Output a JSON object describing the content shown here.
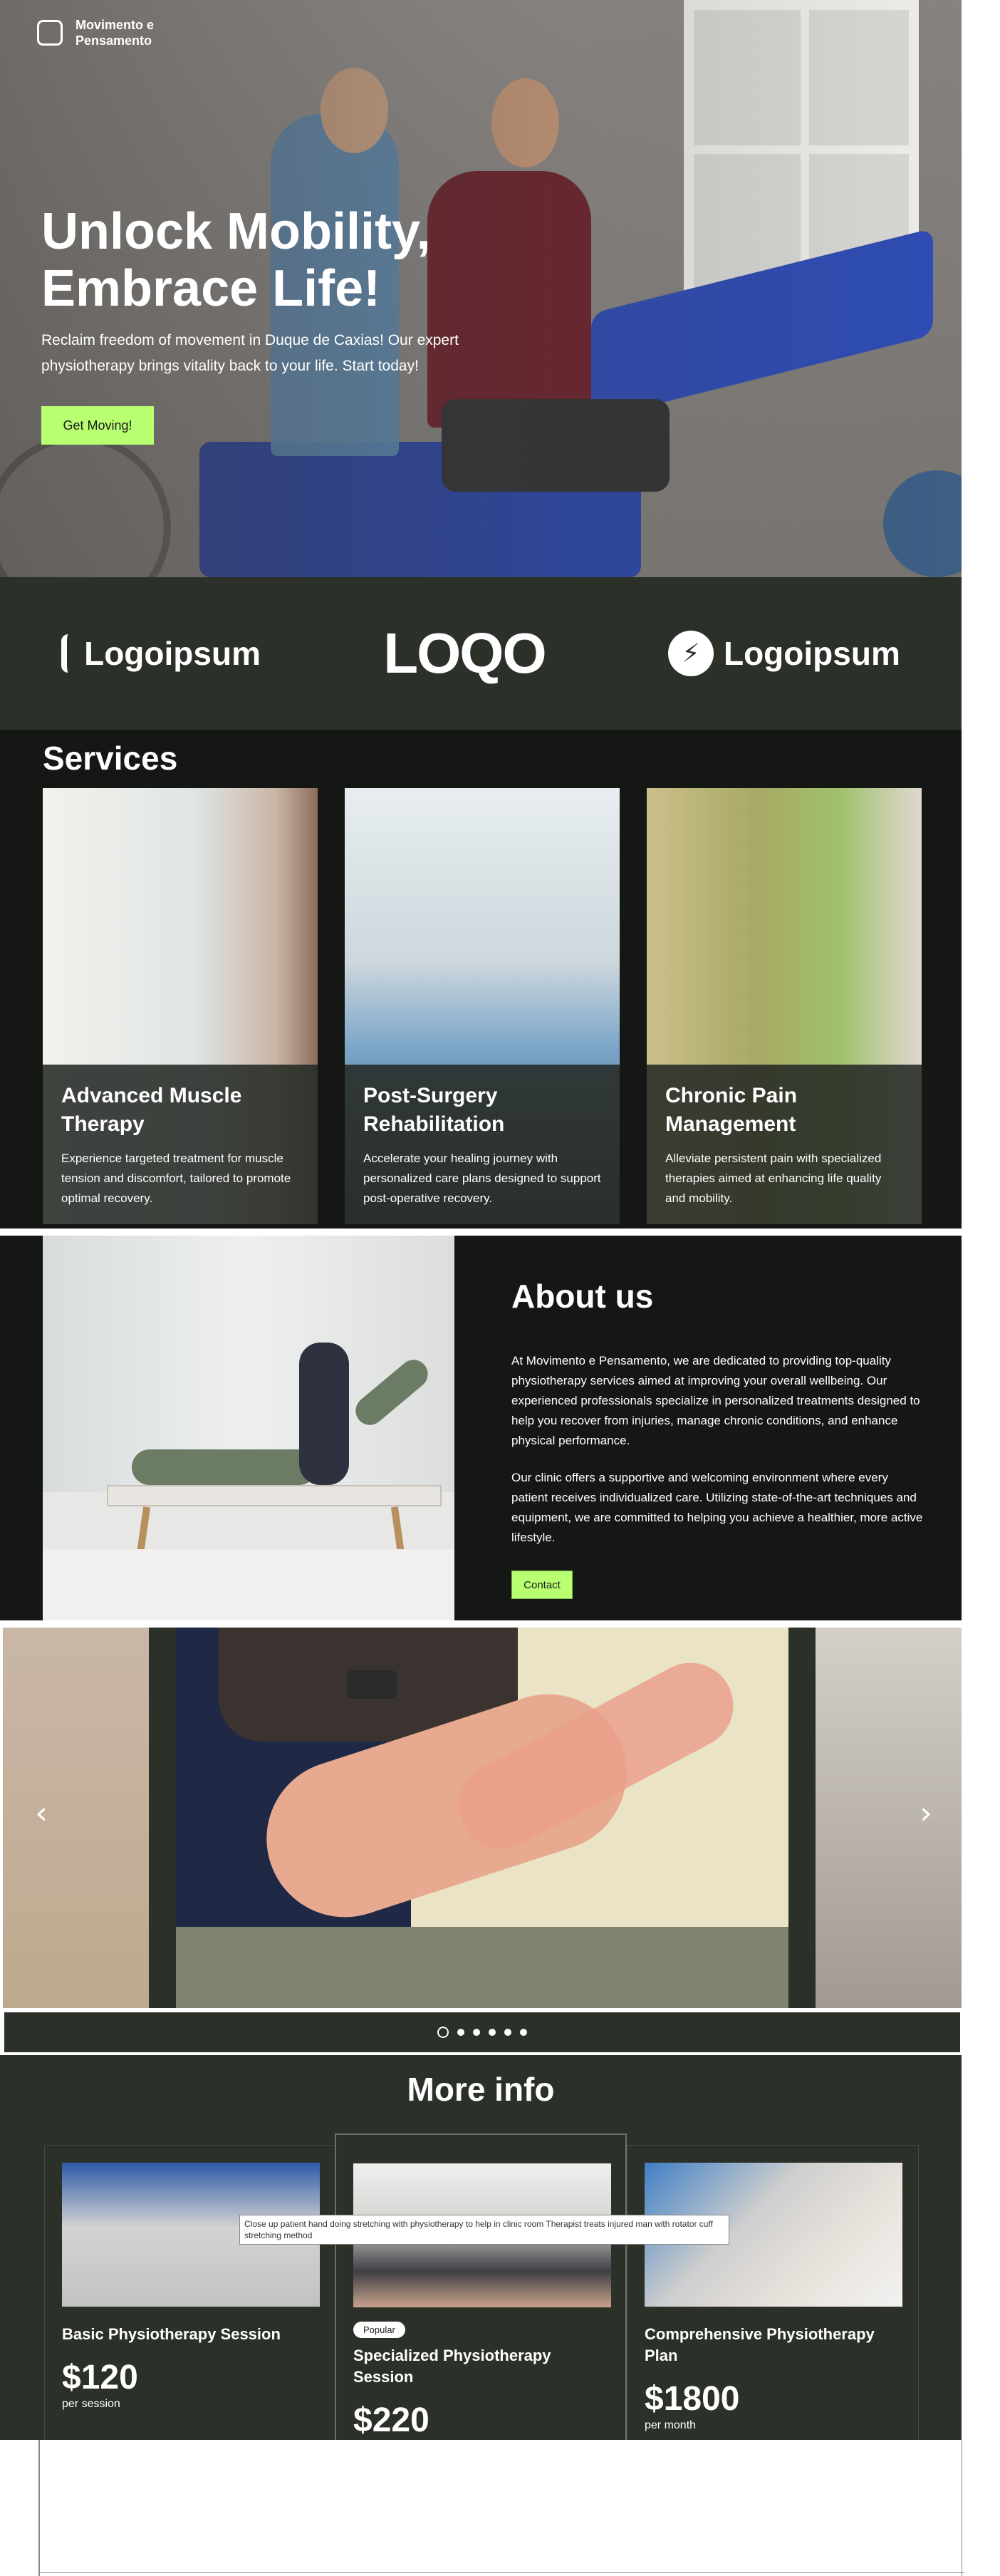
{
  "brand": {
    "name": "Movimento e Pensamento"
  },
  "hero": {
    "title": "Unlock Mobility, Embrace Life!",
    "subtitle": "Reclaim freedom of movement in Duque de Caxias! Our expert physiotherapy brings vitality back to your life. Start today!",
    "cta": "Get Moving!"
  },
  "logos": [
    "Logoipsum",
    "LOQO",
    "Logoipsum"
  ],
  "services": {
    "heading": "Services",
    "items": [
      {
        "title": "Advanced Muscle Therapy",
        "desc": "Experience targeted treatment for muscle tension and discomfort, tailored to promote optimal recovery."
      },
      {
        "title": "Post-Surgery Rehabilitation",
        "desc": "Accelerate your healing journey with personalized care plans designed to support post-operative recovery."
      },
      {
        "title": "Chronic Pain Management",
        "desc": "Alleviate persistent pain with specialized therapies aimed at enhancing life quality and mobility."
      }
    ]
  },
  "about": {
    "heading": "About us",
    "p1": "At Movimento e Pensamento, we are dedicated to providing top-quality physiotherapy services aimed at improving your overall wellbeing. Our experienced professionals specialize in personalized treatments designed to help you recover from injuries, manage chronic conditions, and enhance physical performance.",
    "p2": "Our clinic offers a supportive and welcoming environment where every patient receives individualized care. Utilizing state-of-the-art techniques and equipment, we are committed to helping you achieve a healthier, more active lifestyle.",
    "button": "Contact"
  },
  "carousel": {
    "prev_icon": "chevron-left-icon",
    "next_icon": "chevron-right-icon",
    "prev": "‹",
    "next": "›",
    "slide_count": 6,
    "active_index": 0
  },
  "more_info": {
    "heading": "More info",
    "plans": [
      {
        "title": "Basic Physiotherapy Session",
        "price": "$120",
        "per": "per session",
        "badge": ""
      },
      {
        "title": "Specialized Physiotherapy Session",
        "price": "$220",
        "per": "",
        "badge": "Popular"
      },
      {
        "title": "Comprehensive Physiotherapy Plan",
        "price": "$1800",
        "per": "per month",
        "badge": ""
      }
    ],
    "tooltip": "Close up patient hand doing stretching with physiotherapy to help in clinic room Therapist treats injured man with rotator cuff stretching method"
  },
  "colors": {
    "accent": "#b8ff71",
    "dark": "#151714",
    "panel": "#2b3128"
  }
}
